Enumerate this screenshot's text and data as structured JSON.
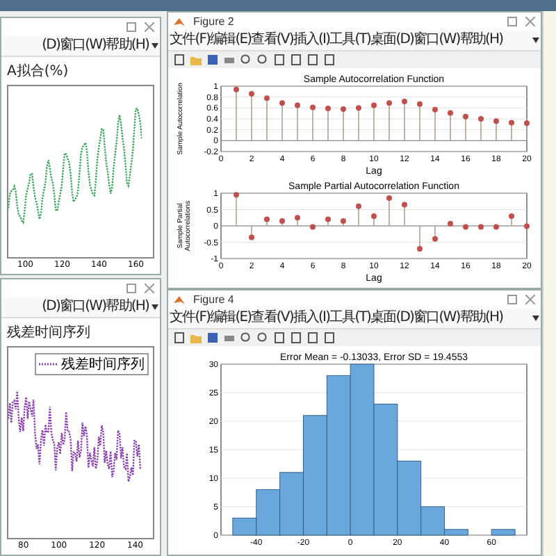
{
  "windows": [
    {
      "kind": "series",
      "menu": [
        "(D)",
        "窗口(W)",
        "帮助(H)"
      ],
      "chart_title": "A拟合(%)",
      "x_tick_labels": [
        "100",
        "120",
        "140",
        "160"
      ],
      "color": "#3aa55a"
    },
    {
      "kind": "series",
      "menu": [
        "(D)",
        "窗口(W)",
        "帮助(H)"
      ],
      "chart_title": "残差时间序列",
      "legend": "残差时间序列",
      "x_tick_labels": [
        "80",
        "100",
        "120",
        "140"
      ],
      "color": "#8a3fb0"
    },
    {
      "kind": "figure",
      "title": "Figure 2",
      "menu": [
        "文件(F)",
        "编辑(E)",
        "查看(V)",
        "插入(I)",
        "工具(T)",
        "桌面(D)",
        "窗口(W)",
        "帮助(H)"
      ],
      "plots": [
        {
          "chart_data": {
            "type": "scatter",
            "title": "Sample Autocorrelation Function",
            "xlabel": "Lag",
            "ylabel": "Sample Autocorrelation",
            "x": [
              1,
              2,
              3,
              4,
              5,
              6,
              7,
              8,
              9,
              10,
              11,
              12,
              13,
              14,
              15,
              16,
              17,
              18,
              19,
              20
            ],
            "values": [
              0.94,
              0.86,
              0.78,
              0.69,
              0.65,
              0.61,
              0.59,
              0.58,
              0.6,
              0.65,
              0.69,
              0.72,
              0.67,
              0.57,
              0.51,
              0.44,
              0.4,
              0.36,
              0.33,
              0.32
            ],
            "xlim": [
              0,
              20
            ],
            "ylim": [
              -0.2,
              1
            ],
            "xticks": [
              0,
              2,
              4,
              6,
              8,
              10,
              12,
              14,
              16,
              18,
              20
            ],
            "yticks": [
              -0.2,
              0,
              0.2,
              0.4,
              0.6,
              0.8,
              1
            ],
            "grid": true
          }
        },
        {
          "chart_data": {
            "type": "scatter",
            "title": "Sample Partial Autocorrelation Function",
            "xlabel": "Lag",
            "ylabel": "Sample Partial Autocorrelations",
            "x": [
              1,
              2,
              3,
              4,
              5,
              6,
              7,
              8,
              9,
              10,
              11,
              12,
              13,
              14,
              15,
              16,
              17,
              18,
              19,
              20
            ],
            "values": [
              0.95,
              -0.35,
              0.2,
              0.15,
              0.25,
              -0.03,
              0.2,
              0.15,
              0.6,
              0.3,
              0.85,
              0.65,
              -0.7,
              -0.4,
              0.07,
              -0.03,
              -0.03,
              -0.03,
              0.3,
              -0.01
            ],
            "xlim": [
              0,
              20
            ],
            "ylim": [
              -1,
              1
            ],
            "xticks": [
              0,
              2,
              4,
              6,
              8,
              10,
              12,
              14,
              16,
              18,
              20
            ],
            "yticks": [
              -1,
              -0.5,
              0,
              0.5,
              1
            ],
            "grid": true
          }
        }
      ]
    },
    {
      "kind": "figure",
      "title": "Figure 4",
      "menu": [
        "文件(F)",
        "编辑(E)",
        "查看(V)",
        "插入(I)",
        "工具(T)",
        "桌面(D)",
        "窗口(W)",
        "帮助(H)"
      ],
      "plots": [
        {
          "chart_data": {
            "type": "bar",
            "title": "Error Mean = -0.13033, Error SD = 19.4553",
            "x": [
              -45,
              -35,
              -25,
              -15,
              -5,
              5,
              15,
              25,
              35,
              45,
              55,
              65
            ],
            "values": [
              3,
              8,
              11,
              21,
              28,
              30,
              23,
              13,
              5,
              1,
              0,
              1
            ],
            "xlim": [
              -55,
              75
            ],
            "ylim": [
              0,
              30
            ],
            "xticks": [
              -40,
              -20,
              0,
              20,
              40,
              60
            ],
            "yticks": [
              0,
              5,
              10,
              15,
              20,
              25,
              30
            ],
            "grid": true
          }
        }
      ]
    }
  ]
}
